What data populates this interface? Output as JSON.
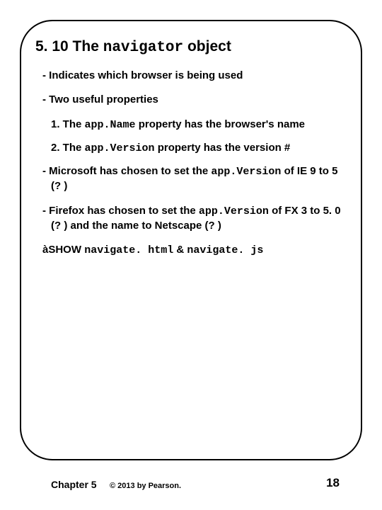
{
  "heading": {
    "num_prefix": "5. 10 The ",
    "mono": "navigator",
    "suffix": " object"
  },
  "bullets": {
    "b1": "- Indicates which browser is being used",
    "b2": "- Two useful properties",
    "s1_pre": "1. The ",
    "s1_mono": "app.Name",
    "s1_post": " property has the browser's name",
    "s2_pre": "2. The ",
    "s2_mono": "app.Version",
    "s2_post": " property has the version #",
    "b3_pre": "- Microsoft has chosen to set the ",
    "b3_mono": "app.Version",
    "b3_post": " of IE 9 to 5 (? )",
    "b4_pre": "- Firefox has chosen to set the ",
    "b4_mono": "app.Version",
    "b4_post": " of FX 3 to 5. 0 (? ) and the name to Netscape (? )",
    "b5_arrow": "à",
    "b5_pre": "SHOW ",
    "b5_mono1": "navigate. html",
    "b5_amp": " & ",
    "b5_mono2": "navigate. js"
  },
  "footer": {
    "chapter": "Chapter 5",
    "copyright": "© 2013 by Pearson.",
    "page": "18"
  }
}
